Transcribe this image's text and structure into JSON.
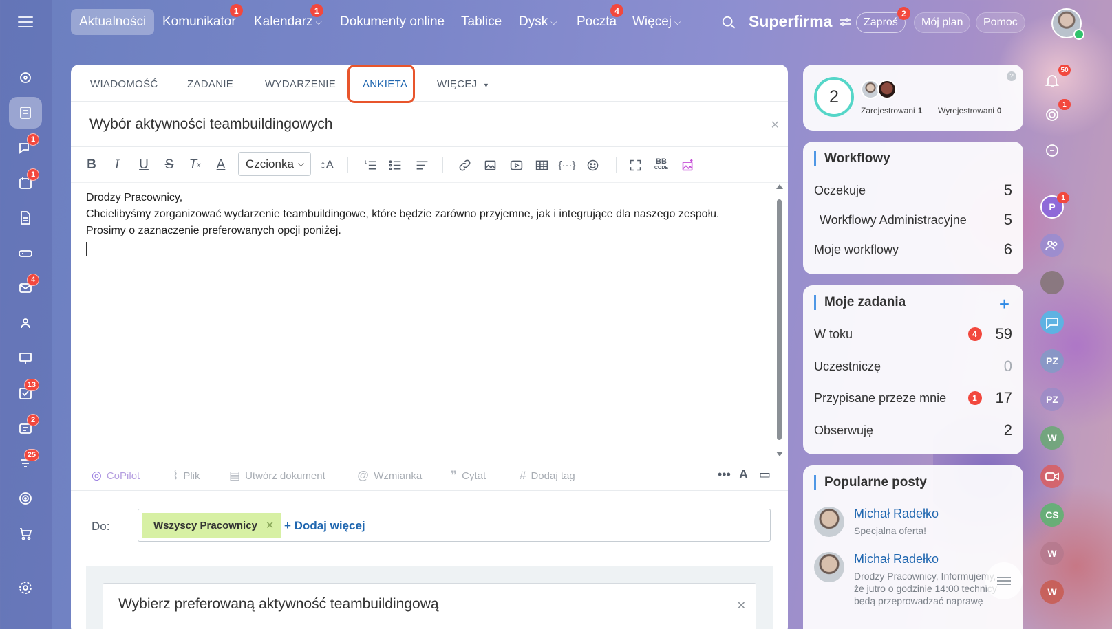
{
  "nav": {
    "items": [
      {
        "label": "Aktualności",
        "badge": "",
        "chevron": false,
        "active": true
      },
      {
        "label": "Komunikator",
        "badge": "1",
        "chevron": false
      },
      {
        "label": "Kalendarz",
        "badge": "1",
        "chevron": true
      },
      {
        "label": "Dokumenty online",
        "badge": "",
        "chevron": false
      },
      {
        "label": "Tablice",
        "badge": "",
        "chevron": false
      },
      {
        "label": "Dysk",
        "badge": "",
        "chevron": true
      },
      {
        "label": "Poczta",
        "badge": "4",
        "chevron": false
      },
      {
        "label": "Więcej",
        "badge": "",
        "chevron": true
      }
    ],
    "brand": "Superfirma",
    "invite_label": "Zaproś",
    "invite_badge": "2",
    "plan_label": "Mój plan",
    "help_label": "Pomoc"
  },
  "left_rail": {
    "badges": {
      "chat": "1",
      "calendar": "1",
      "mail": "4",
      "tasks": "13",
      "crm": "2",
      "filters": "25"
    }
  },
  "editor": {
    "tabs": [
      "WIADOMOŚĆ",
      "ZADANIE",
      "WYDARZENIE",
      "ANKIETA",
      "WIĘCEJ"
    ],
    "title": "Wybór aktywności teambuildingowych",
    "font_select": "Czcionka",
    "body_lines": [
      "Drodzy Pracownicy,",
      "Chcielibyśmy zorganizować wydarzenie teambuildingowe, które będzie zarówno przyjemne, jak i integrujące dla naszego zespołu.",
      "Prosimy o zaznaczenie preferowanych opcji poniżej."
    ],
    "bottom_tools": [
      "CoPilot",
      "Plik",
      "Utwórz dokument",
      "Wzmianka",
      "Cytat",
      "Dodaj tag"
    ],
    "to_label": "Do:",
    "recipient": "Wszyscy Pracownicy",
    "add_more": "Dodaj więcej",
    "poll_question": "Wybierz preferowaną aktywność teambuildingową"
  },
  "online": {
    "count": "2",
    "registered_label": "Zarejestrowani",
    "registered_value": "1",
    "unregistered_label": "Wyrejestrowani",
    "unregistered_value": "0"
  },
  "workflows": {
    "title": "Workflowy",
    "rows": [
      {
        "label": "Oczekuje",
        "value": "5"
      },
      {
        "label": "Workflowy Administracyjne",
        "value": "5"
      },
      {
        "label": "Moje workflowy",
        "value": "6"
      }
    ]
  },
  "tasks": {
    "title": "Moje zadania",
    "rows": [
      {
        "label": "W toku",
        "badge": "4",
        "value": "59"
      },
      {
        "label": "Uczestniczę",
        "badge": "",
        "value": "0"
      },
      {
        "label": "Przypisane przeze mnie",
        "badge": "1",
        "value": "17"
      },
      {
        "label": "Obserwuję",
        "badge": "",
        "value": "2"
      }
    ]
  },
  "popular": {
    "title": "Popularne posty",
    "posts": [
      {
        "author": "Michał Radełko",
        "text": "Specjalna oferta!"
      },
      {
        "author": "Michał Radełko",
        "text": "Drodzy Pracownicy, Informujemy, że jutro o godzinie 14:00 technicy będą przeprowadzać naprawę"
      }
    ]
  },
  "right_rail": {
    "notifications": "50",
    "goals_badge": "1",
    "p_badge": "1",
    "avatars": [
      "P",
      "PZ",
      "PZ",
      "W",
      "CS",
      "W",
      "W"
    ]
  },
  "colors": {
    "accent": "#2067b0",
    "badge": "#f2483e",
    "highlight": "#e8552c",
    "tag": "#d7f0a4"
  }
}
